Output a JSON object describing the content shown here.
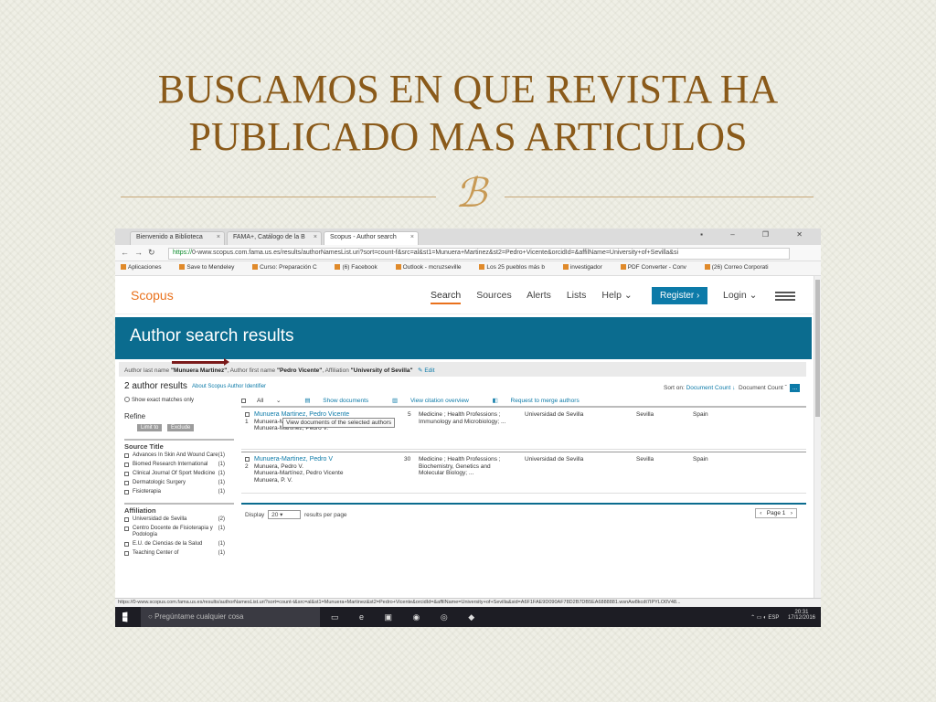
{
  "slide": {
    "title_line1": "BUSCAMOS EN QUE REVISTA HA",
    "title_line2": "PUBLICADO MAS ARTICULOS",
    "ornament": "ℬ"
  },
  "browser": {
    "tabs": [
      {
        "label": "Bienvenido a Biblioteca"
      },
      {
        "label": "FAMA+, Catálogo de la B"
      },
      {
        "label": "Scopus - Author search"
      }
    ],
    "window_buttons": "▪ – ❐ ✕",
    "url_secure": "https://",
    "url": "0-www.scopus.com.fama.us.es/results/authorNamesList.uri?sort=count-f&src=al&st1=Munuera+Martinez&st2=Pedro+Vicente&orcidId=&affilName=University+of+Sevilla&si",
    "bookmarks": [
      "Aplicaciones",
      "Save to Mendeley",
      "Curso: Preparación C",
      "(6) Facebook",
      "Outlook - mcruzseville",
      "Los 25 pueblos más b",
      "investigador",
      "PDF Converter - Conv",
      "(26) Correo Corporati"
    ],
    "status_url": "https://0-www.scopus.com.fama.us.es/results/authorNamesList.uri?sort=count-t&src=al&st1=Munuera+Martinez&st2=Pedro+Vicente&orcidId=&affilName=University+of+Sevilla&sid=A6F1FAE9D090AF78D2B7DB5EA6888881.wsnAw8kcdt7IPYLO0V48..."
  },
  "scopus": {
    "logo": "Scopus",
    "nav": [
      "Search",
      "Sources",
      "Alerts",
      "Lists",
      "Help ⌄"
    ],
    "register": "Register ›",
    "login": "Login ⌄",
    "results_title": "Author search results",
    "query": {
      "prefix": "Author last name",
      "last": "\"Munuera Martinez\"",
      "mid1": ", Author first name",
      "first": "\"Pedro Vicente\"",
      "mid2": ", Affiliation",
      "affil": "\"University of Sevilla\"",
      "edit": "Edit"
    },
    "count_number": "2",
    "count_label": "author results",
    "about": "About Scopus Author Identifier",
    "sort_label": "Sort on:",
    "sort_value": "Document Count ↓",
    "sort_dropdown": "Document Count",
    "exact": "Show exact matches only",
    "refine": "Refine",
    "limit": "Limit to",
    "exclude": "Exclude",
    "source_title": {
      "heading": "Source Title",
      "items": [
        {
          "label": "Advances In Skin And Wound Care",
          "count": "(1)"
        },
        {
          "label": "Biomed Research International",
          "count": "(1)"
        },
        {
          "label": "Clinical Journal Of Sport Medicine",
          "count": "(1)"
        },
        {
          "label": "Dermatologic Surgery",
          "count": "(1)"
        },
        {
          "label": "Fisioterapia",
          "count": "(1)"
        }
      ]
    },
    "affiliation": {
      "heading": "Affiliation",
      "items": [
        {
          "label": "Universidad de Sevilla",
          "count": "(2)"
        },
        {
          "label": "Centro Docente de Fisioterapia y Podología",
          "count": "(1)"
        },
        {
          "label": "E.U. de Ciencias de la Salud",
          "count": "(1)"
        },
        {
          "label": "Teaching Center of",
          "count": "(1)"
        }
      ]
    },
    "toolbar": {
      "all": "All",
      "show_docs": "Show documents",
      "citation": "View citation overview",
      "merge": "Request to merge authors"
    },
    "tooltip": "View documents of the selected authors",
    "rows": [
      {
        "index": "1",
        "name": "Munuera Martinez, Pedro Vicente",
        "variants": "Munuera-Martínez, Pedro V.\nMunuera-Martinez, Pedro V.",
        "docs": "5",
        "subjects": "Medicine ; Health Professions ;\nImmunology and Microbiology; ...",
        "affiliation": "Universidad de Sevilla",
        "city": "Sevilla",
        "country": "Spain"
      },
      {
        "index": "2",
        "name": "Munuera-Martinez, Pedro V",
        "variants": "Munuera, Pedro V.\nMunuera-Martínez, Pedro Vicente\nMunuera, P. V.",
        "docs": "30",
        "subjects": "Medicine ; Health Professions ;\nBiochemistry, Genetics and\nMolecular Biology; ...",
        "affiliation": "Universidad de Sevilla",
        "city": "Sevilla",
        "country": "Spain"
      }
    ],
    "display_label": "Display",
    "display_value": "20",
    "display_suffix": "results per page",
    "page_label": "Page 1"
  },
  "taskbar": {
    "search_placeholder": "Pregúntame cualquier cosa",
    "time": "20:31",
    "date": "17/12/2016",
    "lang": "ESP"
  }
}
